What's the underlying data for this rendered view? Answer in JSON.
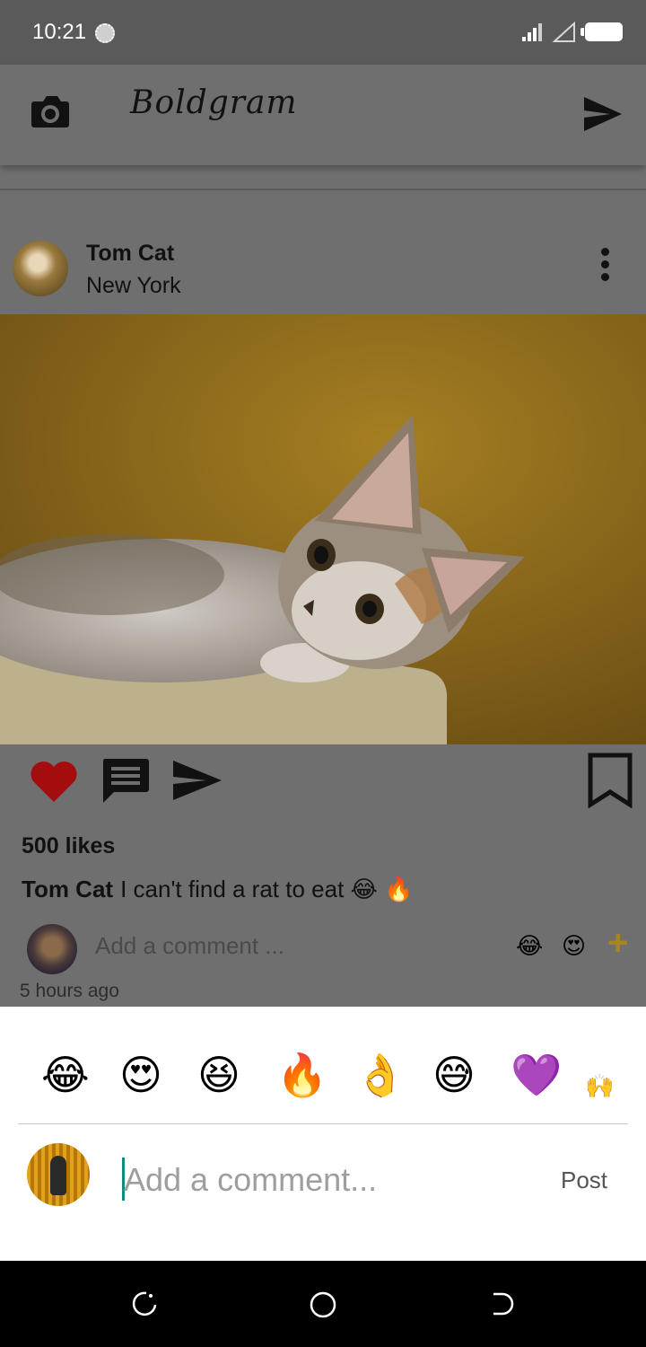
{
  "status_bar": {
    "time": "10:21"
  },
  "app_bar": {
    "title": "Boldgram",
    "camera_icon": "camera-icon",
    "send_icon": "send-icon"
  },
  "post": {
    "username": "Tom Cat",
    "location": "New York",
    "image_alt": "kitten",
    "likes": "500 likes",
    "caption_user": "Tom Cat",
    "caption_text": "I can't find a rat to eat 😂 🔥",
    "comment_placeholder": "Add a comment ...",
    "quick_emojis": [
      "😂",
      "😍"
    ],
    "add_emoji": "+",
    "time_ago": "5 hours ago",
    "liked": true,
    "colors": {
      "like": "#a30d0d"
    }
  },
  "sheet": {
    "emojis": [
      "😂",
      "😍",
      "😆",
      "🔥",
      "👌",
      "😅",
      "💜",
      "🙌"
    ],
    "input_placeholder": "Add a comment...",
    "post_label": "Post",
    "accent": "#138a80"
  }
}
